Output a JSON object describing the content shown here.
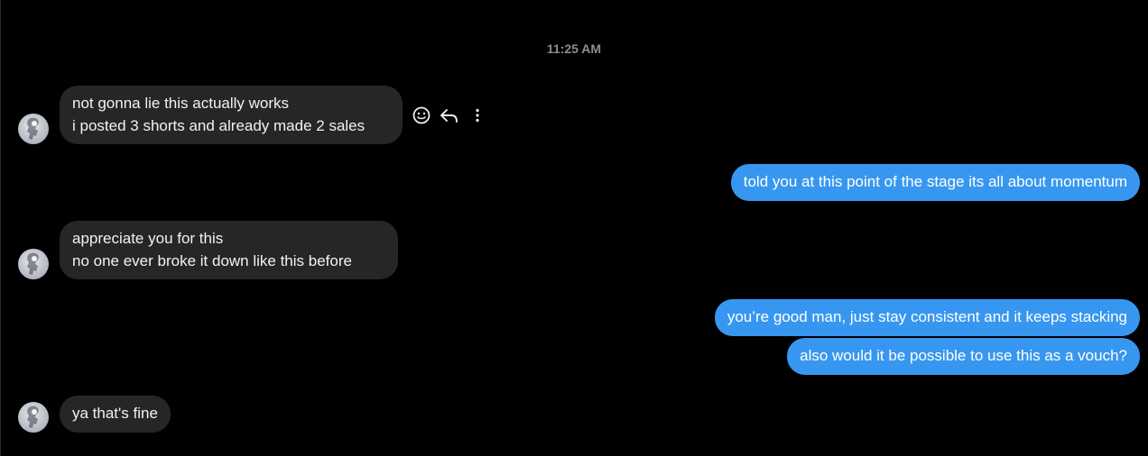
{
  "thread": {
    "timestamp": "11:25 AM",
    "messages": [
      {
        "sender": "them",
        "lines": [
          "not gonna lie this actually works",
          "i posted 3 shorts and already made 2 sales"
        ]
      },
      {
        "sender": "me",
        "lines": [
          "told you at this point of the stage its all about momentum"
        ]
      },
      {
        "sender": "them",
        "lines": [
          "appreciate you for this",
          "no one ever broke it down like this before"
        ]
      },
      {
        "sender": "me",
        "lines": [
          "you’re good man, just stay consistent and it keeps stacking"
        ]
      },
      {
        "sender": "me",
        "lines": [
          "also would it be possible to use this as a vouch?"
        ]
      },
      {
        "sender": "them",
        "lines": [
          "ya that's fine"
        ]
      }
    ]
  },
  "message_actions": {
    "icons": [
      "emoji-reaction-icon",
      "reply-icon",
      "more-options-icon"
    ]
  },
  "colors": {
    "background": "#000000",
    "incoming_bubble": "#262626",
    "outgoing_bubble": "#3797f0",
    "timestamp_text": "#8a8d91"
  }
}
